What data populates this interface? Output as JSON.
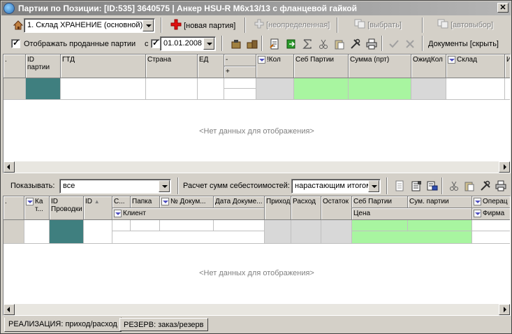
{
  "window": {
    "title": "Партии по Позиции: [ID:535] 3640575  |  Анкер HSU-R M6x13/13 с фланцевой гайкой",
    "close": "✕"
  },
  "toolbar1": {
    "warehouse_value": "1. Склад ХРАНЕНИЕ (основной)",
    "new_batch": "[новая партия]",
    "undefined": "[неопределенная]",
    "select": "[выбрать]",
    "auto_select": "[автовыбор]"
  },
  "toolbar2": {
    "show_sold_label": "Отображать проданные партии",
    "from_label": "с",
    "date_value": "01.01.2008",
    "documents_toggle": "Документы [скрыть]"
  },
  "grid1": {
    "columns": {
      "dot": ".",
      "id_batch": "ID\nпартии",
      "gtd": "ГТД",
      "country": "Страна",
      "unit": "ЕД",
      "minus": "-",
      "plus": "+",
      "qty": "!Кол",
      "cost": "Себ Партии",
      "sum": "Сумма (прт)",
      "expected": "ОжидКол",
      "warehouse": "Склад",
      "extra": "И"
    },
    "empty_text": "<Нет данных для отображения>"
  },
  "toolbar3": {
    "show_label": "Показывать:",
    "show_value": "все",
    "calc_label": "Расчет сумм себестоимостей:",
    "calc_value": "нарастающим итогом"
  },
  "grid2": {
    "columns": {
      "dot": ".",
      "kat": "Ка\nт...",
      "id_entry": "ID\nПроводки",
      "id": "ID",
      "c": "С...",
      "folder": "Папка",
      "doc_no": "№ Докум...",
      "doc_date": "Дата Докуме...",
      "client": "Клиент",
      "income": "Приход",
      "outcome": "Расход",
      "remain": "Остаток",
      "cost": "Себ Партии",
      "price": "Цена",
      "batch_sum": "Сум. партии",
      "operation": "Операц",
      "firm": "Фирма"
    },
    "empty_text": "<Нет данных для отображения>"
  },
  "tabs": [
    {
      "label": "РЕАЛИЗАЦИЯ: приход/расход",
      "active": true
    },
    {
      "label": "РЕЗЕРВ: заказ/резерв",
      "active": false
    }
  ],
  "colors": {
    "teal": "#3f7f7f",
    "green": "#a8f5a0",
    "gray_cell": "#d8d8d8"
  }
}
